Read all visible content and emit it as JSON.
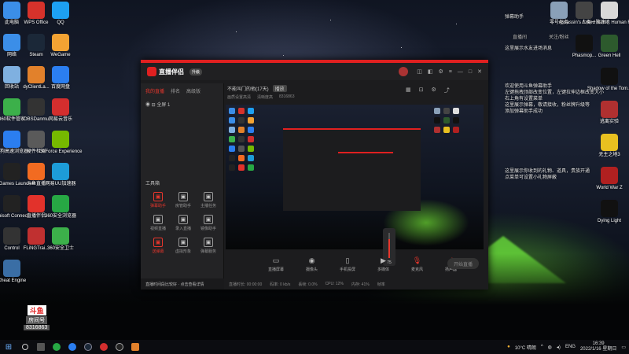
{
  "desktop": {
    "left_icons": [
      {
        "label": "此电脑",
        "icon": "computer-icon",
        "color": "#3b8ee8"
      },
      {
        "label": "WPS Office",
        "icon": "wps-icon",
        "color": "#d6322b"
      },
      {
        "label": "QQ",
        "icon": "qq-icon",
        "color": "#1da0f2"
      },
      {
        "label": "网络",
        "icon": "network-icon",
        "color": "#3b8ee8"
      },
      {
        "label": "Steam",
        "icon": "steam-icon",
        "color": "#1b2838"
      },
      {
        "label": "WeGame",
        "icon": "wegame-icon",
        "color": "#f3a333"
      },
      {
        "label": "回收站",
        "icon": "recycle-bin-icon",
        "color": "#7fb0e0"
      },
      {
        "label": "dyClientLa...",
        "icon": "douyin-icon",
        "color": "#e2812b"
      },
      {
        "label": "百度网盘",
        "icon": "baidu-disk-icon",
        "color": "#2b7ef0"
      },
      {
        "label": "360软件管家",
        "icon": "360-manager-icon",
        "color": "#3cb04a"
      },
      {
        "label": "OBSDanmu",
        "icon": "obs-icon",
        "color": "#333333"
      },
      {
        "label": "网易云音乐",
        "icon": "netease-music-icon",
        "color": "#d32e2e"
      },
      {
        "label": "搜狗高速浏览器",
        "icon": "sogou-browser-icon",
        "color": "#2b7ef0"
      },
      {
        "label": "硬件检测",
        "icon": "hardware-icon",
        "color": "#5a5a5a"
      },
      {
        "label": "GeForce Experience",
        "icon": "geforce-icon",
        "color": "#76b900"
      },
      {
        "label": "Epic Games Launcher",
        "icon": "epic-icon",
        "color": "#222222"
      },
      {
        "label": "斗鱼直播",
        "icon": "douyu-icon",
        "color": "#f26b21"
      },
      {
        "label": "网易UU加速器",
        "icon": "uu-icon",
        "color": "#1d9cd8"
      },
      {
        "label": "Ubisoft Connect",
        "icon": "ubisoft-icon",
        "color": "#222222"
      },
      {
        "label": "直播伴侣",
        "icon": "live-companion-icon",
        "color": "#e2322b"
      },
      {
        "label": "360安全浏览器",
        "icon": "360-browser-icon",
        "color": "#27a844"
      },
      {
        "label": "Control",
        "icon": "control-icon",
        "color": "#333333"
      },
      {
        "label": "FLiNGTrai...",
        "icon": "fling-icon",
        "color": "#c03030"
      },
      {
        "label": "360安全卫士",
        "icon": "360-safe-icon",
        "color": "#3cb04a"
      },
      {
        "label": "Cheat Engine",
        "icon": "cheat-engine-icon",
        "color": "#3a6ea5"
      }
    ],
    "right_icons": [
      {
        "label": "零号任务",
        "icon": "game-icon",
        "color": "#8aa0b8"
      },
      {
        "label": "Assassin's Creed Valh...",
        "icon": "acv-icon",
        "color": "#444444"
      },
      {
        "label": "人类一败涂地 Human Fa...",
        "icon": "human-icon",
        "color": "#d8d8d8"
      },
      {
        "label": "Phasmop...",
        "icon": "phasmophobia-icon",
        "color": "#111111"
      },
      {
        "label": "Green Hell",
        "icon": "green-hell-icon",
        "color": "#2d5a2d"
      },
      {
        "label": "Shadow of the Tom...",
        "icon": "tomb-raider-icon",
        "color": "#111111"
      },
      {
        "label": "逃离实验",
        "icon": "escape-icon",
        "color": "#b03030"
      },
      {
        "label": "无主之地3",
        "icon": "borderlands-icon",
        "color": "#e8c020"
      },
      {
        "label": "World War Z",
        "icon": "wwz-icon",
        "color": "#b02020"
      },
      {
        "label": "Dying Light",
        "icon": "dying-light-icon",
        "color": "#111111"
      }
    ]
  },
  "notes": {
    "panel_title": "弹幕助手",
    "col1": "直播间",
    "col2": "关注/粉丝",
    "line1": "这里展示水友进场消息",
    "block2": [
      "欢迎使用斗鱼弹幕助手",
      "左键拖拽顶部改变位置，左键拉伸边框改变大小",
      "右上角有设置菜单",
      "这里展示弹幕，敬请接收，粉丝牌升级等",
      "添加弹幕助手成功"
    ],
    "block3": [
      "这里展示你收到的礼物、道具，贵族开通",
      "点菜单可设置小礼物屏蔽"
    ]
  },
  "app": {
    "logo": "直播伴侣",
    "upgrade": "升级",
    "left_tabs": [
      "我的直播",
      "排名",
      "高级版"
    ],
    "scene": "全屏 1",
    "title": "不能叫门的他(17天)",
    "title_tag": "播放",
    "sub": [
      "画质设置高清",
      "清晰度高",
      "8316863"
    ],
    "tool_header": "工具箱",
    "tools": [
      {
        "label": "弹幕助手",
        "icon": "danmu-icon",
        "red": true
      },
      {
        "label": "房管助手",
        "icon": "admin-icon",
        "red": false
      },
      {
        "label": "主播任务",
        "icon": "task-icon",
        "red": false
      },
      {
        "label": "视频直播",
        "icon": "video-icon",
        "red": false
      },
      {
        "label": "录入直播",
        "icon": "record-icon",
        "red": false
      },
      {
        "label": "镜像助手",
        "icon": "mirror-icon",
        "red": false
      },
      {
        "label": "送弹幕",
        "icon": "send-icon",
        "red": true
      },
      {
        "label": "虚拟形象",
        "icon": "avatar-icon",
        "red": false
      },
      {
        "label": "弹幕服务",
        "icon": "service-icon",
        "red": false
      }
    ],
    "bottom": [
      {
        "label": "直播屏幕",
        "icon": "screen-icon"
      },
      {
        "label": "摄像头",
        "icon": "camera-icon"
      },
      {
        "label": "手机投屏",
        "icon": "phone-icon"
      },
      {
        "label": "多媒体",
        "icon": "media-icon"
      },
      {
        "label": "麦克风",
        "icon": "mic-icon"
      },
      {
        "label": "扬声器",
        "icon": "speaker-icon"
      }
    ],
    "volume": 75,
    "golive": "开始直播",
    "status": [
      "直播时长: 00:00:00",
      "码率: 0 kb/s",
      "丢帧: 0.0%",
      "CPU: 12%",
      "内存: 41%",
      "帧率"
    ],
    "notice": "直播时间段比较好 · 点击查看详情"
  },
  "overlay": {
    "b1": "斗鱼",
    "b2": "房间号",
    "room": "8316863"
  },
  "taskbar": {
    "weather": "10°C 晴朗",
    "lang": "ENG",
    "time": "16:39",
    "date": "2022/1/16 星期日"
  }
}
